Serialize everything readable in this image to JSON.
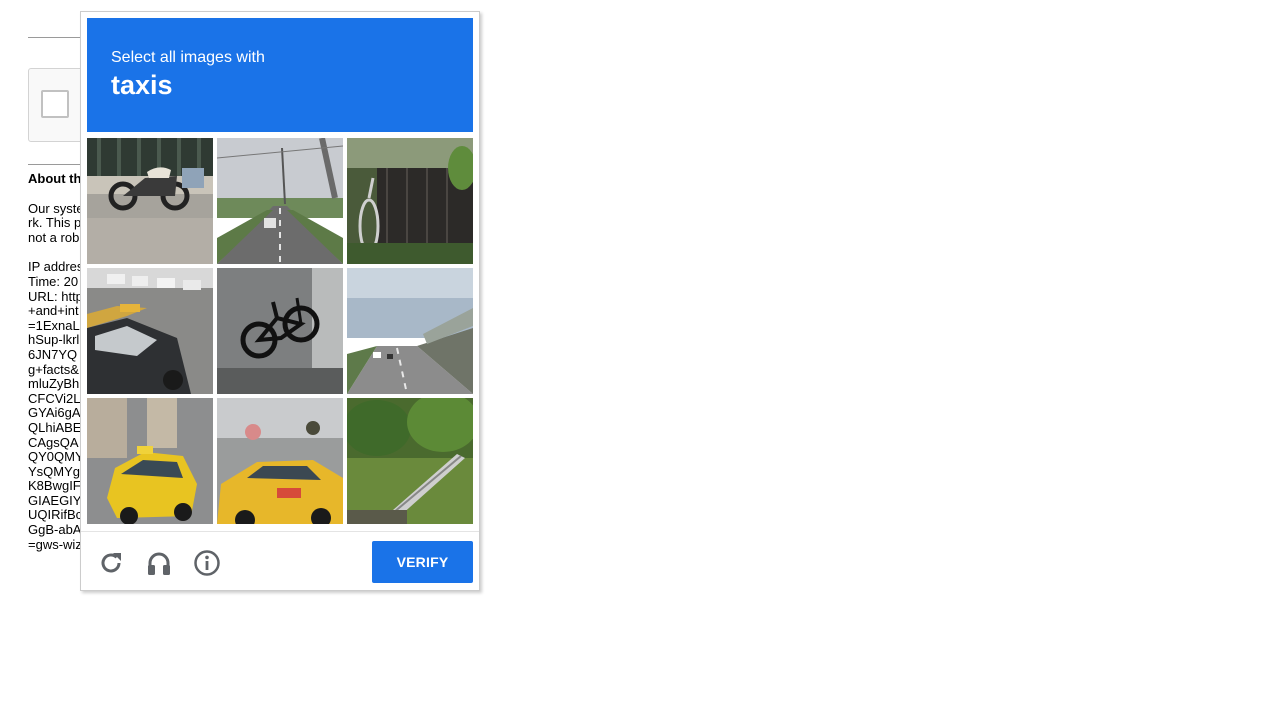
{
  "background_page": {
    "about_heading": "About th",
    "paragraph_lines": [
      "Our syste",
      "rk. This p",
      "not a rob"
    ],
    "info_lines": [
      "IP addres",
      "Time: 20",
      "URL: http",
      "+and+int",
      "=1ExnaL",
      "hSup-lkrl",
      "6JN7YQ",
      "g+facts&",
      "mluZyBh",
      "CFCVi2L",
      "GYAi6gA",
      "QLhiABE",
      "CAgsQA",
      "QY0QMY",
      "YsQMYg",
      "K8BwgIF",
      "GIAEGIY",
      "UQIRifBc",
      "GgB-abA",
      "=gws-wiz"
    ]
  },
  "challenge": {
    "instruction": "Select all images with",
    "keyword": "taxis",
    "colors": {
      "header": "#1a73e8",
      "button": "#1a73e8"
    },
    "tiles": [
      {
        "row": 1,
        "col": 1,
        "depicts": "motorcycle-icon"
      },
      {
        "row": 1,
        "col": 2,
        "depicts": "road-icon"
      },
      {
        "row": 1,
        "col": 3,
        "depicts": "bicycle-icon"
      },
      {
        "row": 2,
        "col": 1,
        "depicts": "taxi-icon"
      },
      {
        "row": 2,
        "col": 2,
        "depicts": "bicycle-icon"
      },
      {
        "row": 2,
        "col": 3,
        "depicts": "highway-icon"
      },
      {
        "row": 3,
        "col": 1,
        "depicts": "taxi-icon"
      },
      {
        "row": 3,
        "col": 2,
        "depicts": "taxi-icon"
      },
      {
        "row": 3,
        "col": 3,
        "depicts": "vegetation-icon"
      }
    ],
    "footer": {
      "reload_icon": "reload-icon",
      "audio_icon": "headphones-icon",
      "info_icon": "info-icon",
      "verify_label": "VERIFY"
    }
  }
}
